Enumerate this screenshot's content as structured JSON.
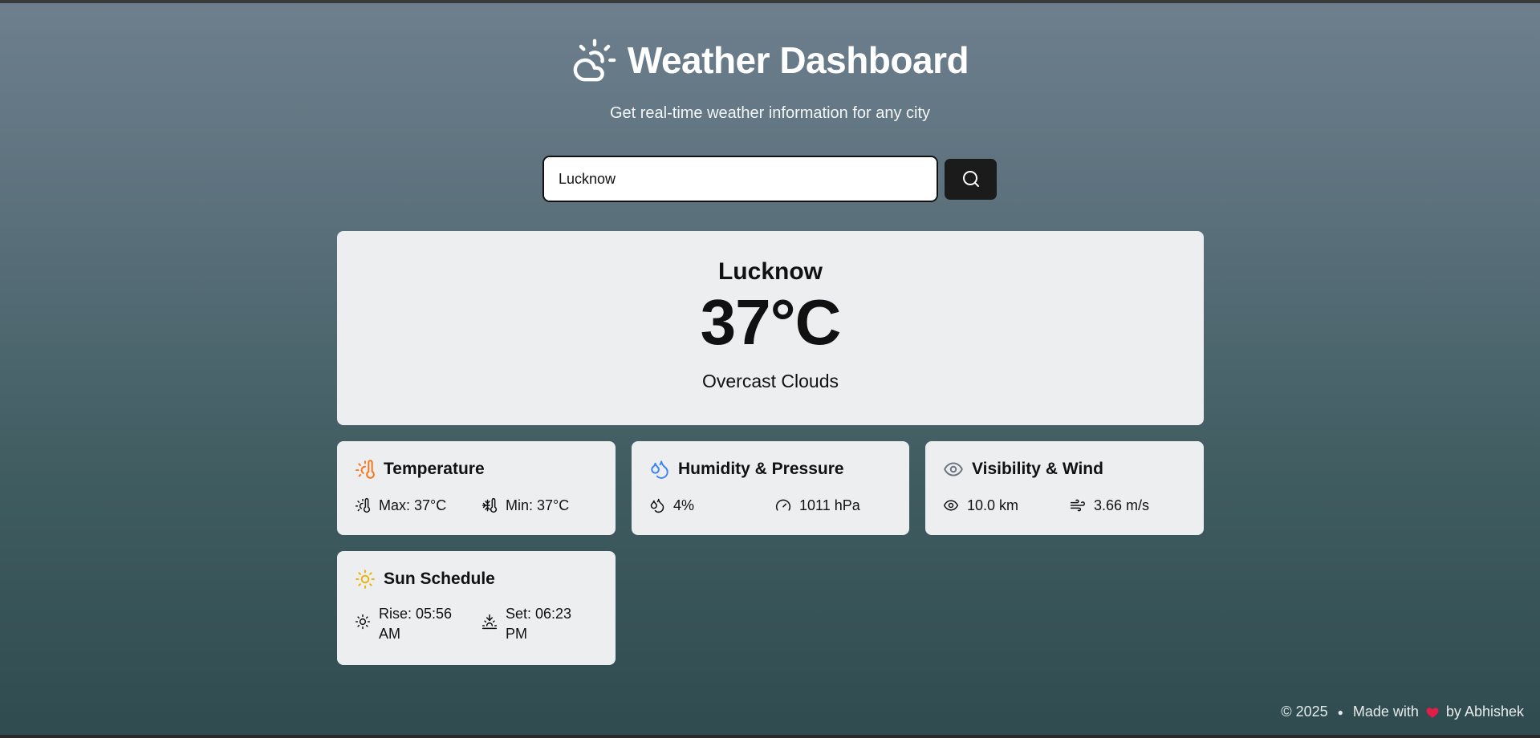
{
  "header": {
    "title": "Weather Dashboard",
    "subtitle": "Get real-time weather information for any city",
    "icon": "cloud-sun-icon"
  },
  "search": {
    "value": "Lucknow",
    "button_icon": "search-icon"
  },
  "current": {
    "city": "Lucknow",
    "temperature": "37°C",
    "description": "Overcast Clouds"
  },
  "cards": {
    "temperature": {
      "title": "Temperature",
      "max": "Max: 37°C",
      "min": "Min: 37°C"
    },
    "humidity": {
      "title": "Humidity & Pressure",
      "humidity": "4%",
      "pressure": "1011 hPa"
    },
    "visibility": {
      "title": "Visibility & Wind",
      "visibility": "10.0 km",
      "wind": "3.66 m/s"
    },
    "sun": {
      "title": "Sun Schedule",
      "rise_line1": "Rise: 05:56",
      "rise_line2": "AM",
      "set_line1": "Set: 06:23",
      "set_line2": "PM"
    }
  },
  "footer": {
    "copyright": "© 2025",
    "made_with": "Made with",
    "by": "by Abhishek"
  },
  "colors": {
    "accent_orange": "#f97316",
    "accent_blue": "#3b82f6",
    "accent_yellow": "#eab308",
    "icon_gray": "#6b7280"
  }
}
